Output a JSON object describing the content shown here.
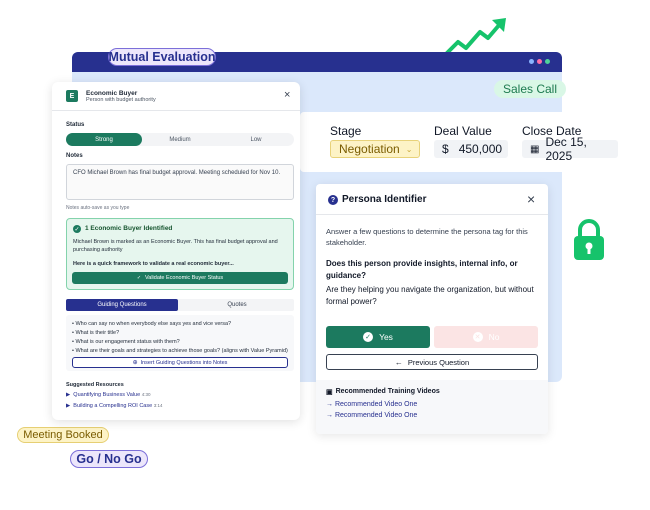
{
  "pills": {
    "mutual": "Mutual Evaluation",
    "sales": "Sales Call",
    "meeting": "Meeting Booked",
    "gonogo": "Go / No Go"
  },
  "deal": {
    "stage_label": "Stage",
    "stage_value": "Negotiation",
    "value_label": "Deal Value",
    "value_currency": "$",
    "value_amount": "450,000",
    "close_label": "Close Date",
    "close_value": "Dec 15, 2025"
  },
  "buyer": {
    "badge": "E",
    "title": "Economic Buyer",
    "subtitle": "Person with budget authority",
    "close": "×",
    "status_label": "Status",
    "status_options": [
      "Strong",
      "Medium",
      "Low"
    ],
    "notes_label": "Notes",
    "notes_text": "CFO Michael Brown has final budget approval. Meeting scheduled for Nov 10.",
    "autosave": "Notes auto-save as you type",
    "identified_title": "1 Economic Buyer Identified",
    "identified_text": "Michael Brown is marked as an Economic Buyer. This has final budget approval and purchasing authority",
    "framework_text": "Here is a quick framework to validate a real economic buyer...",
    "validate_button": "Validate Economic Buyer Status",
    "tabs": [
      "Guiding Questions",
      "Quotes"
    ],
    "questions": [
      "Who can say no when everybody else says yes and vice versa?",
      "What is their title?",
      "What is our engagement status with them?",
      "What are their goals and strategies to achieve those goals? (aligns with Value Pyramid)"
    ],
    "insert_button": "Insert Guiding Questions into Notes",
    "resources_label": "Suggested Resources",
    "resources": [
      {
        "title": "Quantifying Business Value",
        "duration": "4:30"
      },
      {
        "title": "Building a Compelling ROI Case",
        "duration": "3:14"
      }
    ]
  },
  "persona": {
    "title": "Persona Identifier",
    "close": "×",
    "intro": "Answer a few questions to determine the persona tag for this stakeholder.",
    "question": "Does this person provide insights, internal info, or guidance?",
    "subquestion": "Are they helping you navigate the organization, but without formal power?",
    "yes": "Yes",
    "no": "No",
    "previous": "Previous Question",
    "training_label": "Recommended Training Videos",
    "videos": [
      "Recommended Video One",
      "Recommended Video One"
    ]
  },
  "colors": {
    "navy": "#27308f",
    "green": "#1c7a5f",
    "stage_bg": "#fdf3c6",
    "icon_green": "#16c36b",
    "lavender": "#ece6fb"
  }
}
